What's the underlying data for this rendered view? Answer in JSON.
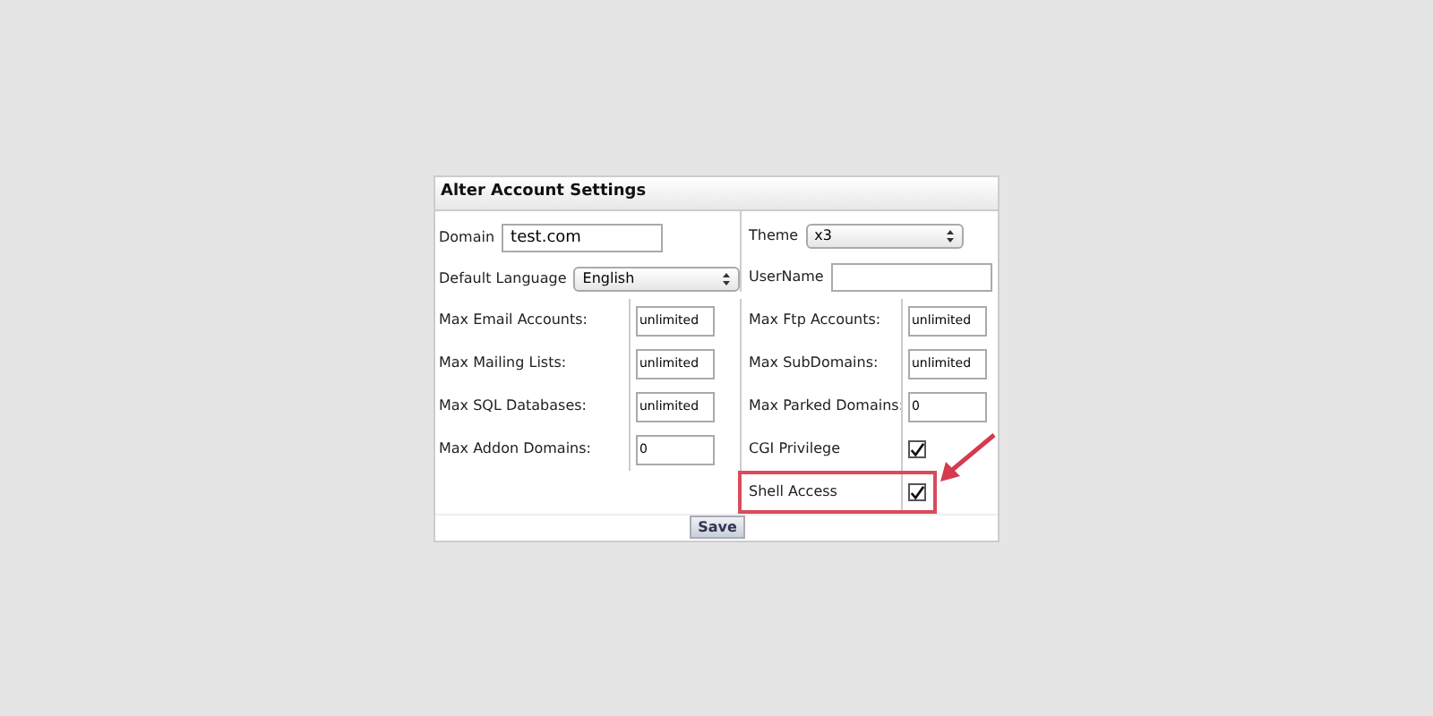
{
  "panel": {
    "title": "Alter Account Settings"
  },
  "top_left": [
    {
      "label": "Domain",
      "kind": "text",
      "value": "test.com"
    },
    {
      "label": "Default Language",
      "kind": "select",
      "value": "English"
    }
  ],
  "top_right": [
    {
      "label": "Theme",
      "kind": "select",
      "value": "x3"
    },
    {
      "label": "UserName",
      "kind": "text"
    }
  ],
  "left": [
    {
      "label": "Max Email Accounts:",
      "kind": "number",
      "value": "unlimited"
    },
    {
      "label": "Max Mailing Lists:",
      "kind": "number",
      "value": "unlimited"
    },
    {
      "label": "Max SQL Databases:",
      "kind": "number",
      "value": "unlimited"
    },
    {
      "label": "Max Addon Domains:",
      "kind": "number",
      "value": "0"
    }
  ],
  "right": [
    {
      "label": "Max Ftp Accounts:",
      "kind": "number",
      "value": "unlimited"
    },
    {
      "label": "Max SubDomains:",
      "kind": "number",
      "value": "unlimited"
    },
    {
      "label": "Max Parked Domains:",
      "kind": "number",
      "value": "0"
    },
    {
      "label": "CGI Privilege",
      "kind": "checkbox",
      "checked": true,
      "highlighted": false
    },
    {
      "label": "Shell Access",
      "kind": "checkbox",
      "checked": true,
      "highlighted": true
    }
  ],
  "save_button": "Save"
}
